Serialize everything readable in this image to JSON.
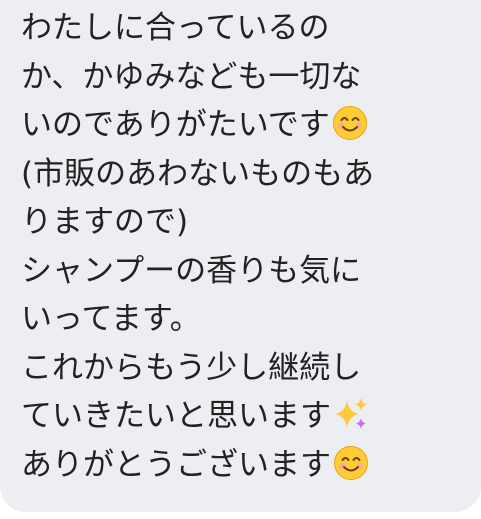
{
  "message": {
    "lines": [
      {
        "text": "わたしに合っているの",
        "emoji": ""
      },
      {
        "text": "か、かゆみなども一切な",
        "emoji": ""
      },
      {
        "text": "いのでありがたいです",
        "emoji": "smiling-face-icon"
      },
      {
        "text": "(市販のあわないものもあ",
        "emoji": ""
      },
      {
        "text": "りますので)",
        "emoji": ""
      },
      {
        "text": "シャンプーの香りも気に",
        "emoji": ""
      },
      {
        "text": "いってます。",
        "emoji": ""
      },
      {
        "text": "これからもう少し継続し",
        "emoji": ""
      },
      {
        "text": "ていきたいと思います",
        "emoji": "sparkles-icon"
      },
      {
        "text": "ありがとうございます",
        "emoji": "smiling-face-icon"
      }
    ]
  },
  "colors": {
    "bubble_background": "#eceef1",
    "text": "#222222"
  }
}
